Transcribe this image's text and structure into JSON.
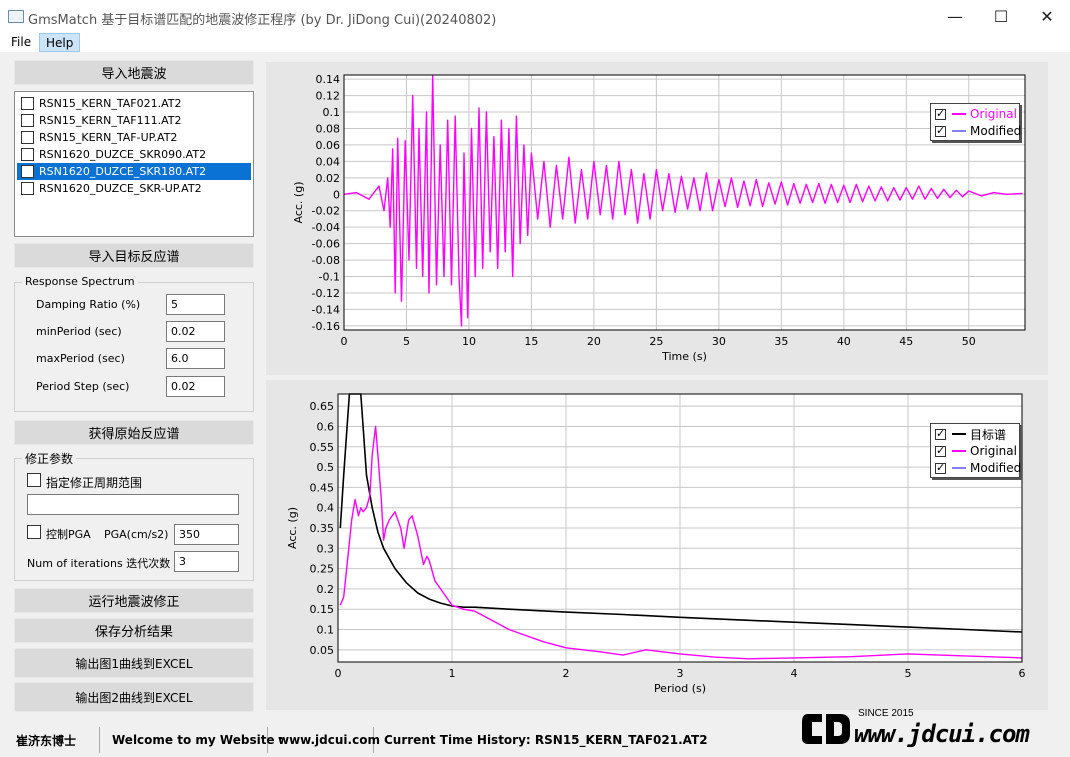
{
  "window": {
    "title": "GmsMatch 基于目标谱匹配的地震波修正程序 (by Dr. JiDong Cui)(20240802)",
    "minimize_glyph": "—",
    "maximize_glyph": "☐",
    "close_glyph": "✕"
  },
  "menu": {
    "file": "File",
    "help": "Help"
  },
  "left": {
    "import_wave_button": "导入地震波",
    "files": [
      {
        "name": "RSN15_KERN_TAF021.AT2",
        "selected": false
      },
      {
        "name": "RSN15_KERN_TAF111.AT2",
        "selected": false
      },
      {
        "name": "RSN15_KERN_TAF-UP.AT2",
        "selected": false
      },
      {
        "name": "RSN1620_DUZCE_SKR090.AT2",
        "selected": false
      },
      {
        "name": "RSN1620_DUZCE_SKR180.AT2",
        "selected": true
      },
      {
        "name": "RSN1620_DUZCE_SKR-UP.AT2",
        "selected": false
      }
    ],
    "import_target_button": "导入目标反应谱",
    "response_spectrum": {
      "title": "Response Spectrum",
      "damping_label": "Damping Ratio (%)",
      "damping_value": "5",
      "min_period_label": "minPeriod (sec)",
      "min_period_value": "0.02",
      "max_period_label": "maxPeriod (sec)",
      "max_period_value": "6.0",
      "period_step_label": "Period Step (sec)",
      "period_step_value": "0.02"
    },
    "get_original_button": "获得原始反应谱",
    "correction": {
      "title": "修正参数",
      "period_range_label": "指定修正周期范围",
      "period_range_value": "",
      "pga_control_label": "控制PGA",
      "pga_label": "PGA(cm/s2)",
      "pga_value": "350",
      "iterations_label": "Num of iterations 迭代次数",
      "iterations_value": "3"
    },
    "run_button": "运行地震波修正",
    "save_button": "保存分析结果",
    "export1_button": "输出图1曲线到EXCEL",
    "export2_button": "输出图2曲线到EXCEL"
  },
  "status": {
    "author": "崔济东博士",
    "welcome": "Welcome to my Website :",
    "website": "www.jdcui.com",
    "current": "Current Time History: RSN15_KERN_TAF021.AT2"
  },
  "watermark": {
    "since": "SINCE 2015",
    "url": "www.jdcui.com"
  },
  "colors": {
    "original": "#ff00ff",
    "modified": "#8080ff",
    "target": "#000000",
    "selection": "#0a72d4"
  },
  "chart_data": [
    {
      "type": "line",
      "xlabel": "Time (s)",
      "ylabel": "Acc. (g)",
      "xlim": [
        0,
        54.5
      ],
      "ylim": [
        -0.165,
        0.145
      ],
      "xticks": [
        0,
        5,
        10,
        15,
        20,
        25,
        30,
        35,
        40,
        45,
        50
      ],
      "yticks": [
        0.14,
        0.12,
        0.1,
        0.08,
        0.06,
        0.04,
        0.02,
        0,
        -0.02,
        -0.04,
        -0.06,
        -0.08,
        -0.1,
        -0.12,
        -0.14,
        -0.16
      ],
      "ytick_labels": [
        "0.14",
        "0.12",
        "0.1",
        "0.08",
        "0.06",
        "0.04",
        "0.02",
        "0",
        "-0.02",
        "-0.04",
        "-0.06",
        "-0.08",
        "-0.1",
        "-0.12",
        "-0.14",
        "-0.16"
      ],
      "grid": true,
      "legend_position": "top-right",
      "legend": [
        "Original",
        "Modified"
      ],
      "series": [
        {
          "name": "Original",
          "x": [
            0,
            1.0,
            2.0,
            2.8,
            3.2,
            3.5,
            3.7,
            3.9,
            4.1,
            4.3,
            4.6,
            4.9,
            5.2,
            5.5,
            5.8,
            6.0,
            6.3,
            6.6,
            6.8,
            7.1,
            7.4,
            7.7,
            8.0,
            8.3,
            8.6,
            8.9,
            9.2,
            9.4,
            9.6,
            9.9,
            10.2,
            10.5,
            10.8,
            11.1,
            11.4,
            11.7,
            12.0,
            12.3,
            12.6,
            12.9,
            13.2,
            13.5,
            13.8,
            14.1,
            14.4,
            14.7,
            15.0,
            15.5,
            16.0,
            16.5,
            17.0,
            17.5,
            18.0,
            18.5,
            19.0,
            19.5,
            20.0,
            20.5,
            21.0,
            21.5,
            22.0,
            22.5,
            23.0,
            23.5,
            24.0,
            24.5,
            25.0,
            25.5,
            26.0,
            26.5,
            27.0,
            27.5,
            28.0,
            28.5,
            29.0,
            29.5,
            30.0,
            30.5,
            31.0,
            31.5,
            32.0,
            32.5,
            33.0,
            33.5,
            34.0,
            34.5,
            35.0,
            35.5,
            36.0,
            36.5,
            37.0,
            37.5,
            38.0,
            38.5,
            39.0,
            39.5,
            40.0,
            40.5,
            41.0,
            41.5,
            42.0,
            42.5,
            43.0,
            43.5,
            44.0,
            44.5,
            45.0,
            45.5,
            46.0,
            46.5,
            47.0,
            47.5,
            48.0,
            48.5,
            49.0,
            49.5,
            50.0,
            51.0,
            52.0,
            53.0,
            54.3
          ],
          "values": [
            0,
            0.002,
            -0.006,
            0.01,
            -0.02,
            0.02,
            -0.04,
            0.055,
            -0.12,
            0.068,
            -0.13,
            0.065,
            -0.08,
            0.12,
            -0.09,
            0.08,
            -0.1,
            0.1,
            -0.12,
            0.144,
            -0.11,
            0.06,
            -0.1,
            0.09,
            -0.11,
            0.095,
            -0.1,
            -0.16,
            0.05,
            -0.15,
            0.08,
            -0.1,
            0.105,
            -0.09,
            0.1,
            -0.07,
            0.07,
            -0.09,
            0.09,
            -0.07,
            0.08,
            -0.1,
            0.095,
            -0.06,
            0.06,
            -0.05,
            0.05,
            -0.03,
            0.04,
            -0.04,
            0.035,
            -0.03,
            0.045,
            -0.035,
            0.03,
            -0.03,
            0.04,
            -0.025,
            0.035,
            -0.03,
            0.04,
            -0.025,
            0.03,
            -0.035,
            0.025,
            -0.03,
            0.03,
            -0.02,
            0.025,
            -0.022,
            0.022,
            -0.018,
            0.02,
            -0.02,
            0.026,
            -0.02,
            0.018,
            -0.015,
            0.02,
            -0.016,
            0.016,
            -0.014,
            0.018,
            -0.015,
            0.014,
            -0.012,
            0.015,
            -0.013,
            0.013,
            -0.011,
            0.012,
            -0.01,
            0.013,
            -0.011,
            0.012,
            -0.01,
            0.011,
            -0.01,
            0.012,
            -0.009,
            0.01,
            -0.008,
            0.009,
            -0.008,
            0.008,
            -0.007,
            0.008,
            -0.006,
            0.01,
            -0.006,
            0.007,
            -0.005,
            0.006,
            -0.004,
            0.005,
            -0.003,
            0.004,
            -0.002,
            0.002,
            0.0,
            0.001
          ]
        },
        {
          "name": "Modified",
          "x": [],
          "values": []
        }
      ]
    },
    {
      "type": "line",
      "xlabel": "Period (s)",
      "ylabel": "Acc. (g)",
      "xlim": [
        0,
        6
      ],
      "ylim": [
        0.02,
        0.68
      ],
      "xticks": [
        0,
        1,
        2,
        3,
        4,
        5,
        6
      ],
      "yticks": [
        0.65,
        0.6,
        0.55,
        0.5,
        0.45,
        0.4,
        0.35,
        0.3,
        0.25,
        0.2,
        0.15,
        0.1,
        0.05
      ],
      "grid": true,
      "legend_position": "top-right",
      "legend": [
        "目标谱",
        "Original",
        "Modified"
      ],
      "series": [
        {
          "name": "目标谱",
          "x": [
            0.02,
            0.05,
            0.08,
            0.1,
            0.12,
            0.15,
            0.2,
            0.22,
            0.25,
            0.3,
            0.35,
            0.4,
            0.5,
            0.6,
            0.7,
            0.8,
            0.9,
            1.0,
            1.1,
            1.2,
            1.5,
            2.0,
            2.5,
            3.0,
            3.5,
            4.0,
            4.5,
            5.0,
            5.5,
            6.0
          ],
          "values": [
            0.35,
            0.48,
            0.6,
            0.68,
            0.68,
            0.68,
            0.68,
            0.6,
            0.48,
            0.4,
            0.34,
            0.3,
            0.25,
            0.215,
            0.19,
            0.175,
            0.165,
            0.158,
            0.155,
            0.155,
            0.15,
            0.143,
            0.137,
            0.13,
            0.124,
            0.118,
            0.112,
            0.106,
            0.1,
            0.094
          ]
        },
        {
          "name": "Original",
          "x": [
            0.02,
            0.05,
            0.08,
            0.12,
            0.15,
            0.18,
            0.2,
            0.22,
            0.25,
            0.28,
            0.3,
            0.33,
            0.35,
            0.38,
            0.4,
            0.42,
            0.45,
            0.5,
            0.55,
            0.58,
            0.62,
            0.65,
            0.7,
            0.75,
            0.78,
            0.8,
            0.85,
            0.9,
            0.95,
            1.0,
            1.1,
            1.2,
            1.3,
            1.5,
            1.8,
            2.0,
            2.3,
            2.5,
            2.7,
            3.0,
            3.3,
            3.6,
            4.0,
            4.5,
            5.0,
            5.5,
            6.0
          ],
          "values": [
            0.16,
            0.18,
            0.26,
            0.37,
            0.42,
            0.38,
            0.4,
            0.39,
            0.4,
            0.43,
            0.53,
            0.6,
            0.53,
            0.42,
            0.32,
            0.35,
            0.37,
            0.39,
            0.35,
            0.3,
            0.37,
            0.38,
            0.33,
            0.26,
            0.28,
            0.27,
            0.22,
            0.2,
            0.18,
            0.16,
            0.15,
            0.145,
            0.13,
            0.1,
            0.07,
            0.055,
            0.045,
            0.037,
            0.05,
            0.04,
            0.032,
            0.028,
            0.03,
            0.033,
            0.04,
            0.035,
            0.03
          ]
        },
        {
          "name": "Modified",
          "x": [],
          "values": []
        }
      ]
    }
  ]
}
